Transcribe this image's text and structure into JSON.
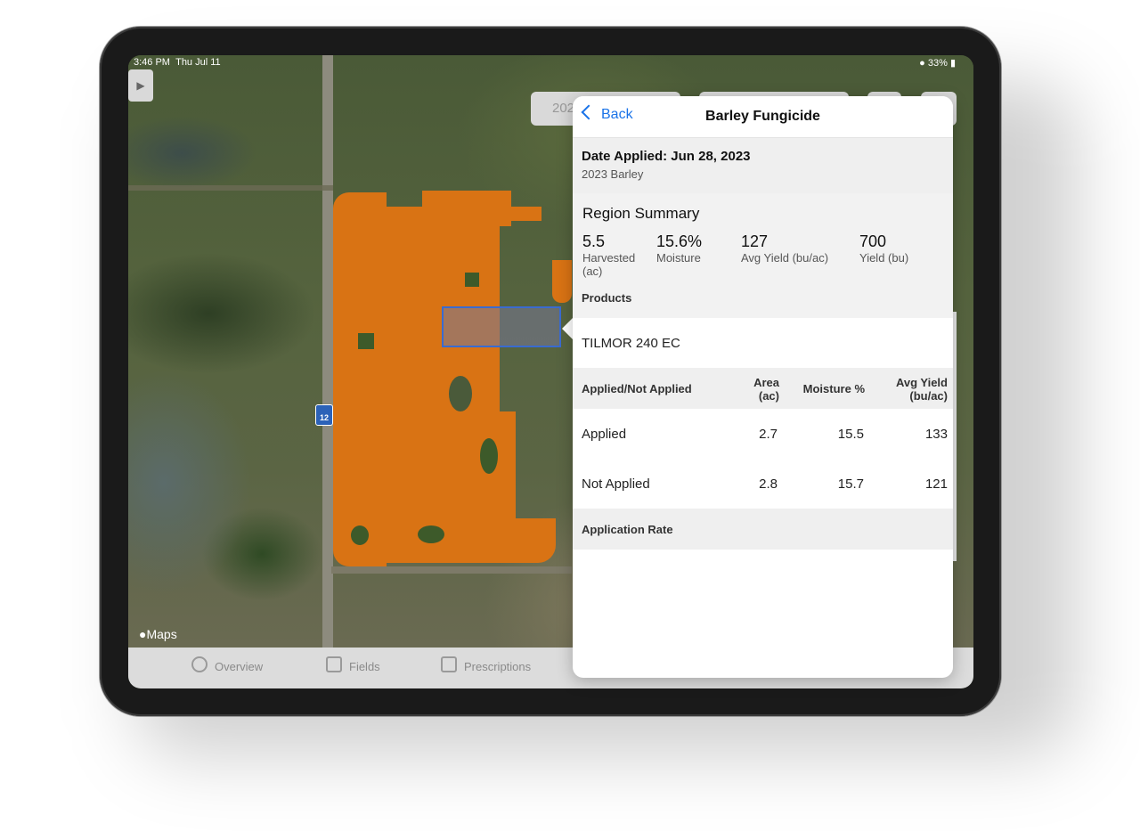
{
  "status_bar": {
    "time": "3:46 PM",
    "date": "Thu Jul 11",
    "battery": "33%"
  },
  "map": {
    "attribution": "Maps",
    "road_shield": "12",
    "season_pill": "202",
    "accent_field_color": "#d97314",
    "selection_color": "#3a6bd0"
  },
  "tab_bar": {
    "tabs": [
      {
        "label": "Overview",
        "icon": "overview-icon"
      },
      {
        "label": "Fields",
        "icon": "fields-icon"
      },
      {
        "label": "Prescriptions",
        "icon": "prescriptions-icon"
      }
    ]
  },
  "popover": {
    "back_label": "Back",
    "title": "Barley Fungicide",
    "date_applied": "Date Applied: Jun 28, 2023",
    "crop_season": "2023 Barley",
    "region_summary": {
      "title": "Region Summary",
      "stats": [
        {
          "value": "5.5",
          "label": "Harvested (ac)"
        },
        {
          "value": "15.6%",
          "label": "Moisture"
        },
        {
          "value": "127",
          "label": "Avg Yield (bu/ac)"
        },
        {
          "value": "700",
          "label": "Yield (bu)"
        }
      ]
    },
    "products_label": "Products",
    "product_name": "TILMOR 240 EC",
    "table": {
      "headers": [
        "Applied/Not Applied",
        "Area (ac)",
        "Moisture %",
        "Avg Yield (bu/ac)"
      ],
      "rows": [
        [
          "Applied",
          "2.7",
          "15.5",
          "133"
        ],
        [
          "Not Applied",
          "2.8",
          "15.7",
          "121"
        ]
      ]
    },
    "application_rate_label": "Application Rate",
    "link_color": "#1a73e8"
  }
}
